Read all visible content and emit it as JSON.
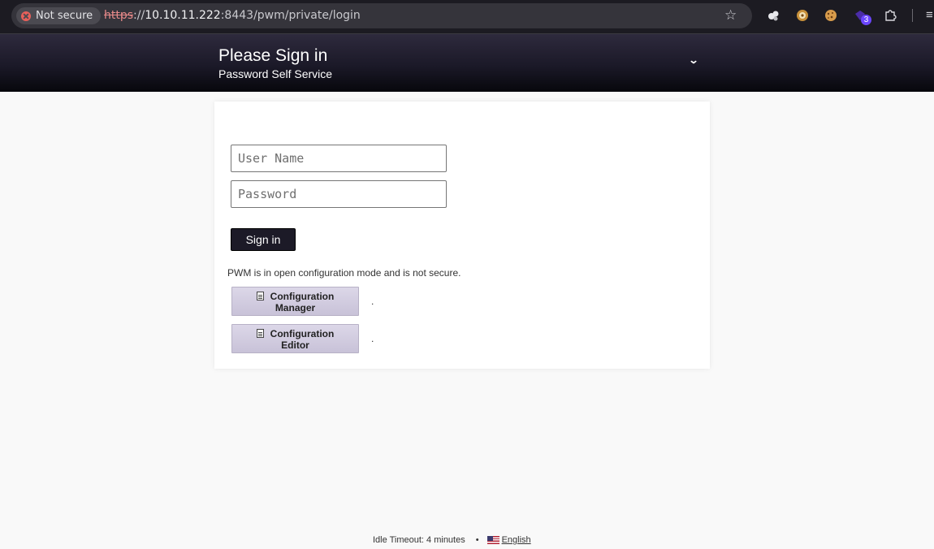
{
  "browser": {
    "security_label": "Not secure",
    "url_scheme": "https",
    "url_rest_prefix": "://",
    "url_host": "10.10.11.222",
    "url_path": ":8443/pwm/private/login",
    "extension_badge": "3",
    "icons": [
      "not-secure-icon",
      "bookmark-star-icon",
      "extension-icon",
      "cookie-icon",
      "puzzle-icon",
      "menu-icon"
    ]
  },
  "header": {
    "title": "Please Sign in",
    "subtitle": "Password Self Service",
    "menu_icon": "chevron-down-icon"
  },
  "login": {
    "username_placeholder": "User Name",
    "password_placeholder": "Password",
    "signin_label": "Sign in"
  },
  "config": {
    "warning": "PWM is in open configuration mode and is not secure.",
    "manager_label_line1": "Configuration",
    "manager_label_line2": "Manager",
    "editor_label_line1": "Configuration",
    "editor_label_line2": "Editor",
    "dot": "."
  },
  "footer": {
    "idle_timeout": "Idle Timeout: 4 minutes",
    "separator": "•",
    "language": "English"
  },
  "colors": {
    "header_dark": "#07070c",
    "header_light": "#2e2a3d",
    "signin_button": "#1c1a27",
    "config_button": "#dcd7e8",
    "page_background": "#f9f9f9"
  }
}
